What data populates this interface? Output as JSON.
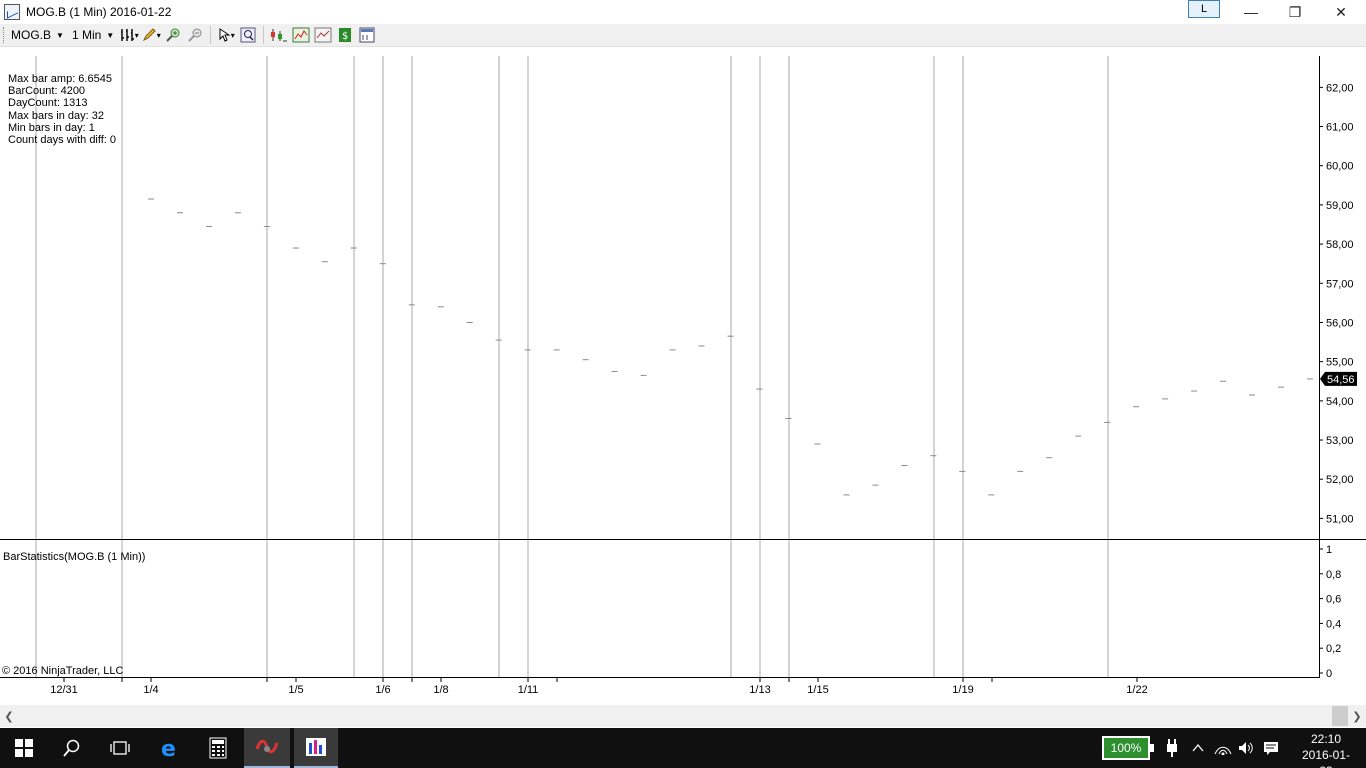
{
  "window": {
    "title": "MOG.B (1 Min)  2016-01-22",
    "l_button": "L",
    "minimize_glyph": "—",
    "restore_glyph": "❐",
    "close_glyph": "✕"
  },
  "toolbar": {
    "instrument": "MOG.B",
    "interval": "1 Min",
    "icons": [
      "bar-type-icon",
      "pencil-draw-icon",
      "zoom-in-icon",
      "zoom-out-icon",
      "cursor-select-icon",
      "magnifier-icon",
      "strategies-icon",
      "indicators-icon",
      "chart-properties-icon",
      "dollar-orders-icon",
      "data-box-icon"
    ]
  },
  "stats": {
    "max_bar_amp": "Max bar amp: 6.6545",
    "bar_count": "BarCount: 4200",
    "day_count": "DayCount: 1313",
    "max_bars_in_day": "Max bars in day: 32",
    "min_bars_in_day": "Min bars in day: 1",
    "count_days_with_diff": "Count days with diff: 0"
  },
  "indicator_label": "BarStatistics(MOG.B (1 Min))",
  "copyright": "© 2016 NinjaTrader, LLC",
  "chart_data": {
    "type": "line",
    "y_axis_ticks": [
      "62,00",
      "61,00",
      "60,00",
      "59,00",
      "58,00",
      "57,00",
      "56,00",
      "55,00",
      "54,00",
      "53,00",
      "52,00",
      "51,00"
    ],
    "ylim": [
      50.5,
      62.8
    ],
    "last_price_label": "54,56",
    "last_price": 54.56,
    "price_marks": [
      59.15,
      58.8,
      58.45,
      58.8,
      58.45,
      57.9,
      57.55,
      57.9,
      57.5,
      56.45,
      56.4,
      56.0,
      55.55,
      55.3,
      55.3,
      55.05,
      54.75,
      54.65,
      55.3,
      55.4,
      55.65,
      54.3,
      53.55,
      52.9,
      51.6,
      51.85,
      52.35,
      52.6,
      52.2,
      51.6,
      52.2,
      52.55,
      53.1,
      53.45,
      53.85,
      54.05,
      54.25,
      54.5,
      54.15,
      54.35,
      54.56
    ],
    "indicator_ticks": [
      "1",
      "0,8",
      "0,6",
      "0,4",
      "0,2",
      "0"
    ],
    "indicator_ylim": [
      0,
      1
    ],
    "x_tick_labels": [
      "12/31",
      "1/4",
      "1/5",
      "1/6",
      "1/8",
      "1/11",
      "1/13",
      "1/15",
      "1/19",
      "1/22"
    ],
    "grid": "vertical session lines",
    "title": ""
  }
}
